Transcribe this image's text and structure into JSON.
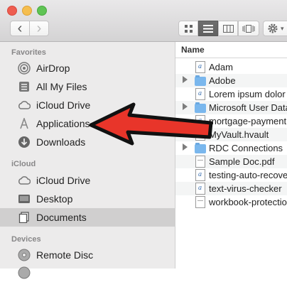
{
  "toolbar": {
    "back_glyph": "‹",
    "forward_glyph": "›"
  },
  "sidebar": {
    "favorites_heading": "Favorites",
    "favorites": [
      {
        "label": "AirDrop",
        "icon": "airdrop-icon"
      },
      {
        "label": "All My Files",
        "icon": "all-my-files-icon"
      },
      {
        "label": "iCloud Drive",
        "icon": "cloud-icon"
      },
      {
        "label": "Applications",
        "icon": "applications-icon"
      },
      {
        "label": "Downloads",
        "icon": "downloads-icon"
      }
    ],
    "icloud_heading": "iCloud",
    "icloud": [
      {
        "label": "iCloud Drive",
        "icon": "cloud-icon"
      },
      {
        "label": "Desktop",
        "icon": "desktop-icon"
      },
      {
        "label": "Documents",
        "icon": "documents-icon",
        "selected": true
      }
    ],
    "devices_heading": "Devices",
    "devices": [
      {
        "label": "Remote Disc",
        "icon": "disc-icon"
      }
    ]
  },
  "list": {
    "column_name": "Name",
    "rows": [
      {
        "name": "Adam",
        "kind": "doc"
      },
      {
        "name": "Adobe",
        "kind": "folder"
      },
      {
        "name": "Lorem ipsum dolor s",
        "kind": "doc"
      },
      {
        "name": "Microsoft User Data",
        "kind": "folder"
      },
      {
        "name": "mortgage-payment",
        "kind": "doc"
      },
      {
        "name": "MyVault.hvault",
        "kind": "plain"
      },
      {
        "name": "RDC Connections",
        "kind": "folder"
      },
      {
        "name": "Sample Doc.pdf",
        "kind": "plain"
      },
      {
        "name": "testing-auto-recove",
        "kind": "doc"
      },
      {
        "name": "text-virus-checker",
        "kind": "doc"
      },
      {
        "name": "workbook-protection",
        "kind": "plain"
      }
    ]
  },
  "annotation": {
    "arrow_color": "#e8352a",
    "points_to": "Applications"
  }
}
